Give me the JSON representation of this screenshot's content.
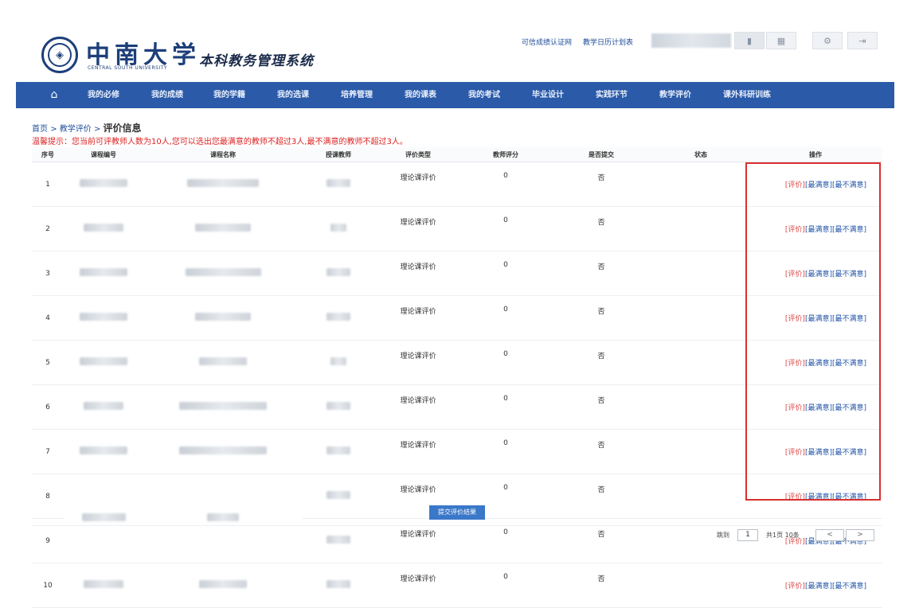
{
  "header": {
    "logo_cn": "中南大学",
    "logo_en": "CENTRAL SOUTH UNIVERSITY",
    "system_title": "本科教务管理系统",
    "top_links": [
      "可信成绩认证网",
      "教学日历计划表"
    ]
  },
  "nav": {
    "items": [
      "我的必修",
      "我的成绩",
      "我的学籍",
      "我的选课",
      "培养管理",
      "我的课表",
      "我的考试",
      "毕业设计",
      "实践环节",
      "教学评价",
      "课外科研训练"
    ]
  },
  "breadcrumb": {
    "home": "首页",
    "parent": "教学评价",
    "current": "评价信息"
  },
  "tip": "温馨提示：您当前可评教师人数为10人,您可以选出您最满意的教师不超过3人,最不满意的教师不超过3人。",
  "table": {
    "headers": [
      "序号",
      "课程编号",
      "课程名称",
      "授课教师",
      "评价类型",
      "教师评分",
      "是否提交",
      "状态",
      "操作"
    ],
    "rows": [
      {
        "no": "1",
        "type": "理论课评价",
        "score": "0",
        "submitted": "否"
      },
      {
        "no": "2",
        "type": "理论课评价",
        "score": "0",
        "submitted": "否"
      },
      {
        "no": "3",
        "type": "理论课评价",
        "score": "0",
        "submitted": "否"
      },
      {
        "no": "4",
        "type": "理论课评价",
        "score": "0",
        "submitted": "否"
      },
      {
        "no": "5",
        "type": "理论课评价",
        "score": "0",
        "submitted": "否"
      },
      {
        "no": "6",
        "type": "理论课评价",
        "score": "0",
        "submitted": "否"
      },
      {
        "no": "7",
        "type": "理论课评价",
        "score": "0",
        "submitted": "否"
      },
      {
        "no": "8",
        "type": "理论课评价",
        "score": "0",
        "submitted": "否"
      },
      {
        "no": "9",
        "type": "理论课评价",
        "score": "0",
        "submitted": "否"
      },
      {
        "no": "10",
        "type": "理论课评价",
        "score": "0",
        "submitted": "否"
      }
    ],
    "ops": {
      "evaluate": "[评价]",
      "most_satisfied": "[最满意]",
      "least_satisfied": "[最不满意]"
    }
  },
  "submit_label": "提交评价结果",
  "pager": {
    "goto_label": "跳到",
    "page_value": "1",
    "summary": "共1页 10条",
    "prev": "<",
    "next": ">"
  }
}
